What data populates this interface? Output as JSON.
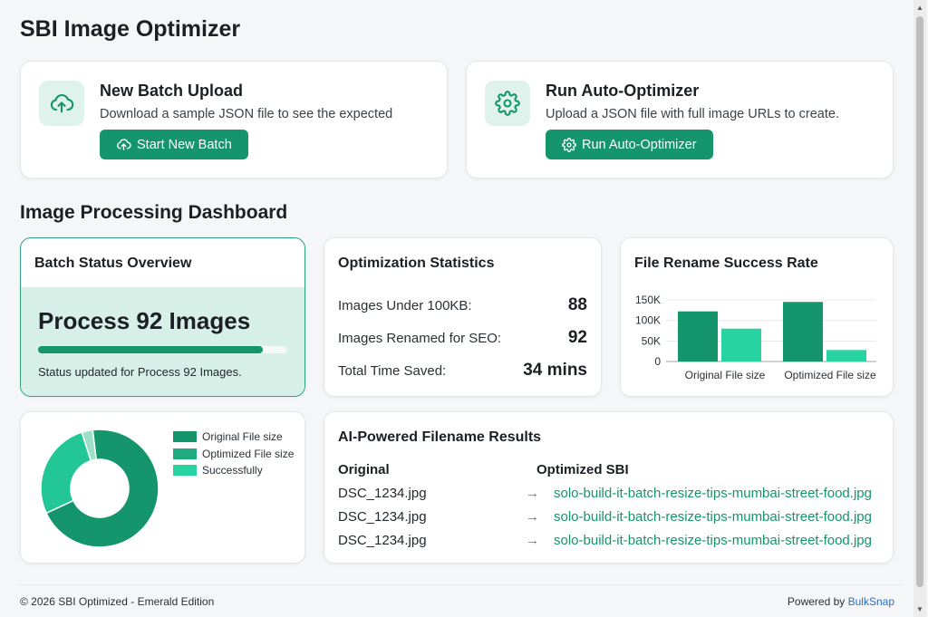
{
  "app": {
    "title": "SBI Image Optimizer"
  },
  "colors": {
    "accent": "#15956c",
    "accent_light": "#28d3a2",
    "panel_tint": "#d7f0e7",
    "link": "#2b6fc2"
  },
  "actions": [
    {
      "icon": "cloud-upload-icon",
      "title": "New Batch Upload",
      "description": "Download a sample JSON file to see the expected",
      "button_label": "Start New Batch"
    },
    {
      "icon": "gear-icon",
      "title": "Run Auto-Optimizer",
      "description": "Upload a JSON file with full image URLs to create.",
      "button_label": "Run Auto-Optimizer"
    }
  ],
  "dashboard": {
    "title": "Image Processing Dashboard"
  },
  "batch": {
    "title": "Batch Status Overview",
    "headline": "Process 92 Images",
    "progress": 0.9,
    "status": "Status updated for Process 92 Images."
  },
  "stats": {
    "title": "Optimization Statistics",
    "rows": [
      {
        "label": "Images Under 100KB:",
        "value": "88"
      },
      {
        "label": "Images Renamed for SEO:",
        "value": "92"
      },
      {
        "label": "Total Time Saved:",
        "value": "34 mins"
      }
    ]
  },
  "chart_data": [
    {
      "type": "bar",
      "title": "File Rename Success Rate",
      "categories": [
        "Original File size",
        "Optimized File size"
      ],
      "series": [
        {
          "values": [
            122000,
            145000
          ],
          "color": "#15956c"
        },
        {
          "values": [
            80000,
            28000
          ],
          "color": "#28d3a2"
        }
      ],
      "ylim": [
        0,
        150000
      ],
      "yticks": [
        0,
        50000,
        100000,
        150000
      ],
      "ytick_labels": [
        "0",
        "50K",
        "100K",
        "150K"
      ],
      "grid": true
    },
    {
      "type": "pie",
      "donut": true,
      "labels": [
        "Original File size",
        "Optimized File size",
        "Successfully"
      ],
      "values": [
        70,
        27,
        3
      ],
      "colors": [
        "#15956c",
        "#23c795",
        "#9ce0c7"
      ],
      "legend_colors": [
        "#15956c",
        "#1eab7e",
        "#28d3a2"
      ],
      "legend": "right"
    }
  ],
  "files": {
    "title": "AI-Powered Filename Results",
    "headers": {
      "original": "Original",
      "optimized": "Optimized SBI"
    },
    "arrow": "→",
    "rows": [
      {
        "original": "DSC_1234.jpg",
        "optimized": "solo-build-it-batch-resize-tips-mumbai-street-food.jpg"
      },
      {
        "original": "DSC_1234.jpg",
        "optimized": "solo-build-it-batch-resize-tips-mumbai-street-food.jpg"
      },
      {
        "original": "DSC_1234.jpg",
        "optimized": "solo-build-it-batch-resize-tips-mumbai-street-food.jpg"
      }
    ]
  },
  "footer": {
    "copyright": "© 2026 SBI Optimized - Emerald Edition",
    "powered_prefix": "Powered by",
    "powered_brand": "BulkSnap"
  }
}
